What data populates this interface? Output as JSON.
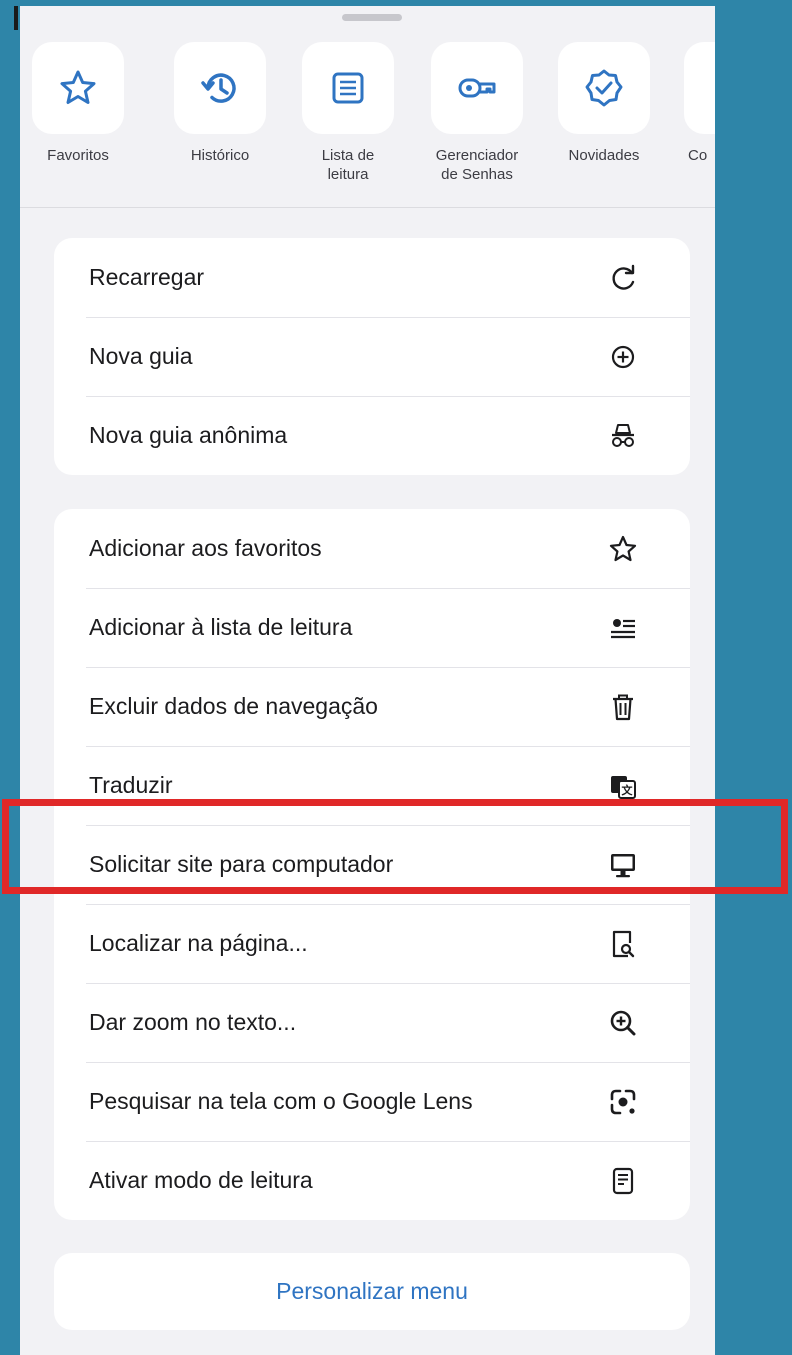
{
  "shortcuts": [
    {
      "label": "Favoritos",
      "icon": "star-icon"
    },
    {
      "label": "Histórico",
      "icon": "history-icon"
    },
    {
      "label": "Lista de\nleitura",
      "icon": "reading-list-icon"
    },
    {
      "label": "Gerenciador\nde Senhas",
      "icon": "key-icon"
    },
    {
      "label": "Novidades",
      "icon": "badge-check-icon"
    },
    {
      "label": "Co",
      "icon": "settings-icon"
    }
  ],
  "group1": [
    {
      "label": "Recarregar",
      "icon": "reload-icon"
    },
    {
      "label": "Nova guia",
      "icon": "plus-circle-icon"
    },
    {
      "label": "Nova guia anônima",
      "icon": "incognito-icon"
    }
  ],
  "group2": [
    {
      "label": "Adicionar aos favoritos",
      "icon": "star-icon"
    },
    {
      "label": "Adicionar à lista de leitura",
      "icon": "add-reading-list-icon"
    },
    {
      "label": "Excluir dados de navegação",
      "icon": "trash-icon"
    },
    {
      "label": "Traduzir",
      "icon": "translate-icon"
    },
    {
      "label": "Solicitar site para computador",
      "icon": "desktop-icon"
    },
    {
      "label": "Localizar na página...",
      "icon": "find-in-page-icon"
    },
    {
      "label": "Dar zoom no texto...",
      "icon": "zoom-in-icon"
    },
    {
      "label": "Pesquisar na tela com o Google Lens",
      "icon": "lens-icon"
    },
    {
      "label": "Ativar modo de leitura",
      "icon": "reader-mode-icon"
    }
  ],
  "personalize_label": "Personalizar menu",
  "colors": {
    "accent": "#2f74c2",
    "background": "#2e85a8",
    "highlight": "#e02828"
  }
}
